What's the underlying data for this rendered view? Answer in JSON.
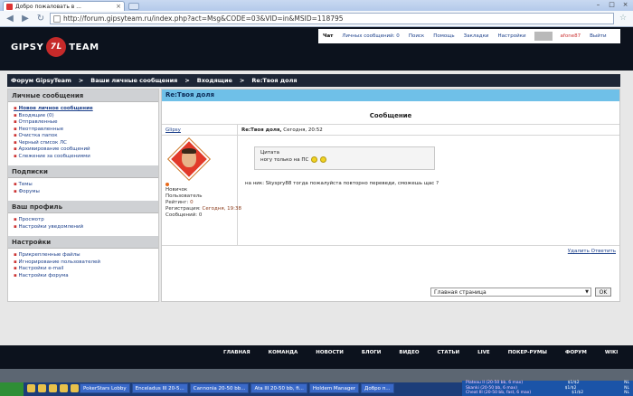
{
  "browser": {
    "tab_title": "Добро пожаловать в ...",
    "tab_close": "×",
    "url": "http://forum.gipsyteam.ru/index.php?act=Msg&CODE=03&VID=in&MSID=118795",
    "back": "◀",
    "forward": "▶",
    "reload": "↻",
    "star": "☆",
    "window": {
      "minimize": "–",
      "maximize": "□",
      "close": "×"
    }
  },
  "site": {
    "logo_left": "GIPSY",
    "logo_mark": "7L",
    "logo_right": "TEAM"
  },
  "userbar": {
    "chat": "Чат",
    "messages": "Личных сообщений: 0",
    "search": "Поиск",
    "help": "Помощь",
    "bookmarks": "Закладки",
    "settings": "Настройки",
    "user": "afone87",
    "logout": "Выйти"
  },
  "breadcrumb": [
    "Форум GipsyTeam",
    ">",
    "Ваши личные сообщения",
    ">",
    "Входящие",
    ">",
    "Re:Твоя доля"
  ],
  "sidebar": {
    "sections": [
      {
        "title": "Личные сообщения",
        "items": [
          "Новое личное сообщение",
          "Входящие (0)",
          "Отправленные",
          "Неотправленные",
          "Очистка папок",
          "Черный список ЛС",
          "Архивирование сообщений",
          "Слежение за сообщениями"
        ]
      },
      {
        "title": "Подписки",
        "items": [
          "Темы",
          "Форумы"
        ]
      },
      {
        "title": "Ваш профиль",
        "items": [
          "Просмотр",
          "Настройки уведомлений"
        ]
      },
      {
        "title": "Настройки",
        "items": [
          "Прикрепленные файлы",
          "Игнорирование пользователей",
          "Настройки e-mail",
          "Настройки форума"
        ]
      }
    ]
  },
  "main": {
    "title": "Re:Твоя доля",
    "section_label": "Сообщение",
    "author": "Glipsy",
    "post_title": "Re:Твоя доля,",
    "post_time": "Сегодня, 20:52",
    "role1": "Новичок",
    "role2": "Пользователь",
    "rating_label": "Рейтинг:",
    "rating_value": "0",
    "reg_label": "Регистрация:",
    "reg_value": "Сегодня, 19:38",
    "msgs_label": "Сообщений:",
    "msgs_value": "0",
    "quote_label": "Цитата",
    "quote_text": "ногу только на ПС",
    "post_text": "на ник: Skyspry88 тогда пожалуйста повторно переведи, сможешь щас ?",
    "delete": "Удалить",
    "reply": "Ответить"
  },
  "jump": {
    "selected": "Главная страница",
    "ok": "OK"
  },
  "footer_nav": [
    "ГЛАВНАЯ",
    "КОМАНДА",
    "НОВОСТИ",
    "БЛОГИ",
    "ВИДЕО",
    "СТАТЬИ",
    "LIVE",
    "ПОКЕР-РУМЫ",
    "ФОРУМ",
    "WIKI"
  ],
  "taskbar": {
    "items": [
      "PokerStars Lobby",
      "Enceladus III 20-5...",
      "Cannonia 20-50 bb...",
      "Ata III 20-50 bb, fi...",
      "Holdem Manager",
      "Добро п..."
    ],
    "tray": [
      {
        "text": "Plateau II (20-50 bb, 6 max)",
        "v1": "$1/$2",
        "v2": "NL"
      },
      {
        "text": "Skanki (20-50 bb, 6 max)",
        "v1": "$1/$2",
        "v2": "NL"
      },
      {
        "text": "Cheat III (20-50 bb, fast, 6 max)",
        "v1": "$1/$2",
        "v2": "NL"
      }
    ]
  }
}
